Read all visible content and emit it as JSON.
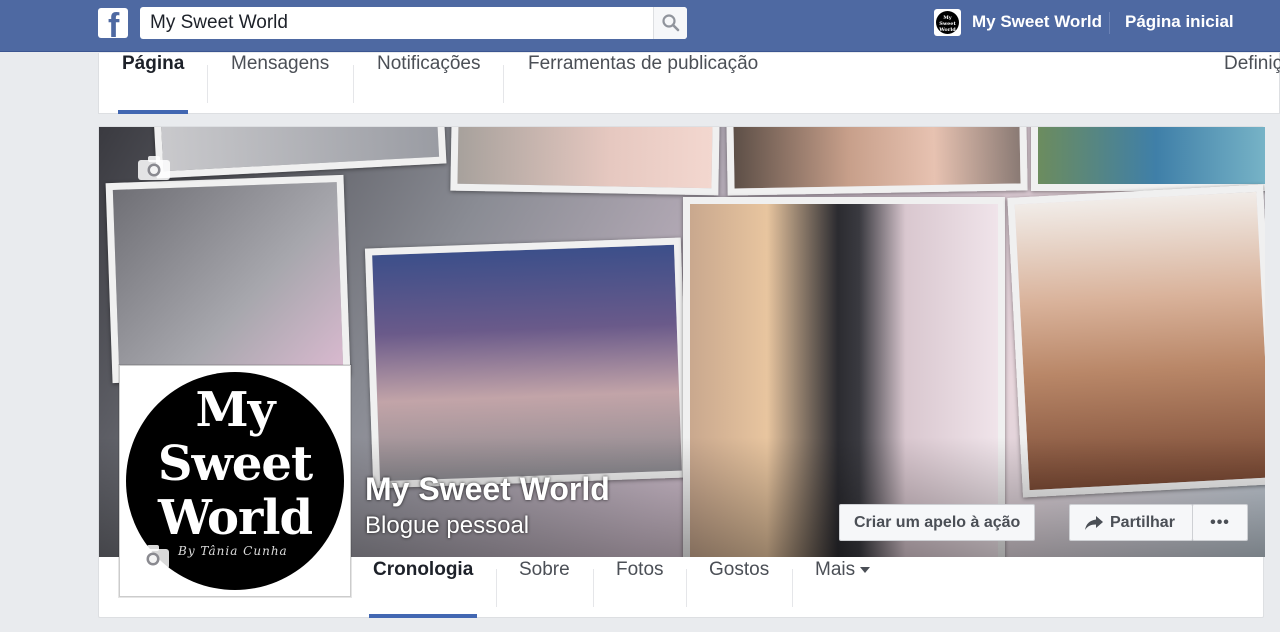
{
  "topbar": {
    "search_value": "My Sweet World",
    "page_name": "My Sweet World",
    "home_label": "Página inicial"
  },
  "page_tabs": [
    {
      "label": "Página",
      "active": true
    },
    {
      "label": "Mensagens",
      "active": false
    },
    {
      "label": "Notificações",
      "active": false
    },
    {
      "label": "Ferramentas de publicação",
      "active": false
    },
    {
      "label": "Definiç",
      "active": false
    }
  ],
  "cover": {
    "title": "My Sweet World",
    "subtitle": "Blogue pessoal",
    "cta_label": "Criar um apelo à ação",
    "share_label": "Partilhar",
    "more_label": "•••"
  },
  "profile_logo": {
    "line1": "My",
    "line2": "Sweet",
    "line3": "World",
    "signature": "By Tânia Cunha"
  },
  "timeline_tabs": [
    {
      "label": "Cronologia",
      "active": true
    },
    {
      "label": "Sobre",
      "active": false
    },
    {
      "label": "Fotos",
      "active": false
    },
    {
      "label": "Gostos",
      "active": false
    },
    {
      "label": "Mais",
      "active": false
    }
  ],
  "colors": {
    "topbar": "#4e69a2",
    "accent": "#4267b2",
    "background": "#e9ebee"
  }
}
